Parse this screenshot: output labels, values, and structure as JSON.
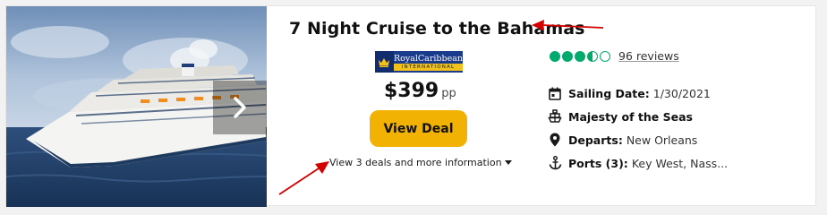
{
  "listing": {
    "title": "7 Night Cruise to the Bahamas",
    "cruise_line": {
      "name_line1": "RoyalCaribbean",
      "name_line2": "INTERNATIONAL"
    },
    "price": {
      "amount": "$399",
      "unit": "pp"
    },
    "view_deal_label": "View Deal",
    "more_info_label": "View 3 deals and more information",
    "rating": {
      "value": 3.5,
      "max": 5,
      "reviews_text": "96 reviews"
    },
    "details": {
      "sailing_date": {
        "label": "Sailing Date:",
        "value": "1/30/2021"
      },
      "ship": {
        "label": "Majesty of the Seas"
      },
      "departs": {
        "label": "Departs:",
        "value": "New Orleans"
      },
      "ports": {
        "label": "Ports (3):",
        "value": "Key West, Nass..."
      }
    }
  },
  "colors": {
    "accent_button": "#f2b203",
    "rating_green": "#00aa6c",
    "annotation_arrow": "#d40000"
  }
}
